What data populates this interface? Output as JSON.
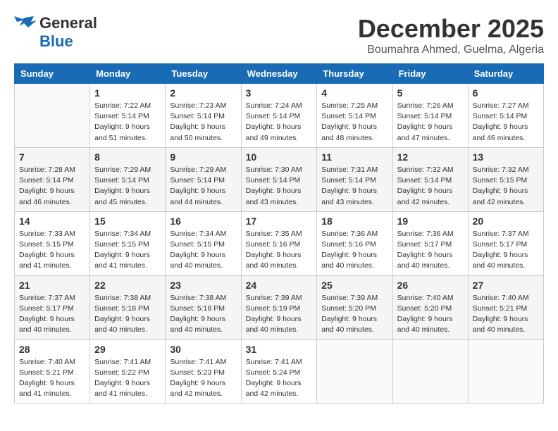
{
  "header": {
    "logo_line1": "General",
    "logo_line2": "Blue",
    "month": "December 2025",
    "location": "Boumahra Ahmed, Guelma, Algeria"
  },
  "columns": [
    "Sunday",
    "Monday",
    "Tuesday",
    "Wednesday",
    "Thursday",
    "Friday",
    "Saturday"
  ],
  "rows": [
    [
      {
        "day": "",
        "info": ""
      },
      {
        "day": "1",
        "info": "Sunrise: 7:22 AM\nSunset: 5:14 PM\nDaylight: 9 hours\nand 51 minutes."
      },
      {
        "day": "2",
        "info": "Sunrise: 7:23 AM\nSunset: 5:14 PM\nDaylight: 9 hours\nand 50 minutes."
      },
      {
        "day": "3",
        "info": "Sunrise: 7:24 AM\nSunset: 5:14 PM\nDaylight: 9 hours\nand 49 minutes."
      },
      {
        "day": "4",
        "info": "Sunrise: 7:25 AM\nSunset: 5:14 PM\nDaylight: 9 hours\nand 48 minutes."
      },
      {
        "day": "5",
        "info": "Sunrise: 7:26 AM\nSunset: 5:14 PM\nDaylight: 9 hours\nand 47 minutes."
      },
      {
        "day": "6",
        "info": "Sunrise: 7:27 AM\nSunset: 5:14 PM\nDaylight: 9 hours\nand 46 minutes."
      }
    ],
    [
      {
        "day": "7",
        "info": "Sunrise: 7:28 AM\nSunset: 5:14 PM\nDaylight: 9 hours\nand 46 minutes."
      },
      {
        "day": "8",
        "info": "Sunrise: 7:29 AM\nSunset: 5:14 PM\nDaylight: 9 hours\nand 45 minutes."
      },
      {
        "day": "9",
        "info": "Sunrise: 7:29 AM\nSunset: 5:14 PM\nDaylight: 9 hours\nand 44 minutes."
      },
      {
        "day": "10",
        "info": "Sunrise: 7:30 AM\nSunset: 5:14 PM\nDaylight: 9 hours\nand 43 minutes."
      },
      {
        "day": "11",
        "info": "Sunrise: 7:31 AM\nSunset: 5:14 PM\nDaylight: 9 hours\nand 43 minutes."
      },
      {
        "day": "12",
        "info": "Sunrise: 7:32 AM\nSunset: 5:14 PM\nDaylight: 9 hours\nand 42 minutes."
      },
      {
        "day": "13",
        "info": "Sunrise: 7:32 AM\nSunset: 5:15 PM\nDaylight: 9 hours\nand 42 minutes."
      }
    ],
    [
      {
        "day": "14",
        "info": "Sunrise: 7:33 AM\nSunset: 5:15 PM\nDaylight: 9 hours\nand 41 minutes."
      },
      {
        "day": "15",
        "info": "Sunrise: 7:34 AM\nSunset: 5:15 PM\nDaylight: 9 hours\nand 41 minutes."
      },
      {
        "day": "16",
        "info": "Sunrise: 7:34 AM\nSunset: 5:15 PM\nDaylight: 9 hours\nand 40 minutes."
      },
      {
        "day": "17",
        "info": "Sunrise: 7:35 AM\nSunset: 5:16 PM\nDaylight: 9 hours\nand 40 minutes."
      },
      {
        "day": "18",
        "info": "Sunrise: 7:36 AM\nSunset: 5:16 PM\nDaylight: 9 hours\nand 40 minutes."
      },
      {
        "day": "19",
        "info": "Sunrise: 7:36 AM\nSunset: 5:17 PM\nDaylight: 9 hours\nand 40 minutes."
      },
      {
        "day": "20",
        "info": "Sunrise: 7:37 AM\nSunset: 5:17 PM\nDaylight: 9 hours\nand 40 minutes."
      }
    ],
    [
      {
        "day": "21",
        "info": "Sunrise: 7:37 AM\nSunset: 5:17 PM\nDaylight: 9 hours\nand 40 minutes."
      },
      {
        "day": "22",
        "info": "Sunrise: 7:38 AM\nSunset: 5:18 PM\nDaylight: 9 hours\nand 40 minutes."
      },
      {
        "day": "23",
        "info": "Sunrise: 7:38 AM\nSunset: 5:18 PM\nDaylight: 9 hours\nand 40 minutes."
      },
      {
        "day": "24",
        "info": "Sunrise: 7:39 AM\nSunset: 5:19 PM\nDaylight: 9 hours\nand 40 minutes."
      },
      {
        "day": "25",
        "info": "Sunrise: 7:39 AM\nSunset: 5:20 PM\nDaylight: 9 hours\nand 40 minutes."
      },
      {
        "day": "26",
        "info": "Sunrise: 7:40 AM\nSunset: 5:20 PM\nDaylight: 9 hours\nand 40 minutes."
      },
      {
        "day": "27",
        "info": "Sunrise: 7:40 AM\nSunset: 5:21 PM\nDaylight: 9 hours\nand 40 minutes."
      }
    ],
    [
      {
        "day": "28",
        "info": "Sunrise: 7:40 AM\nSunset: 5:21 PM\nDaylight: 9 hours\nand 41 minutes."
      },
      {
        "day": "29",
        "info": "Sunrise: 7:41 AM\nSunset: 5:22 PM\nDaylight: 9 hours\nand 41 minutes."
      },
      {
        "day": "30",
        "info": "Sunrise: 7:41 AM\nSunset: 5:23 PM\nDaylight: 9 hours\nand 42 minutes."
      },
      {
        "day": "31",
        "info": "Sunrise: 7:41 AM\nSunset: 5:24 PM\nDaylight: 9 hours\nand 42 minutes."
      },
      {
        "day": "",
        "info": ""
      },
      {
        "day": "",
        "info": ""
      },
      {
        "day": "",
        "info": ""
      }
    ]
  ]
}
